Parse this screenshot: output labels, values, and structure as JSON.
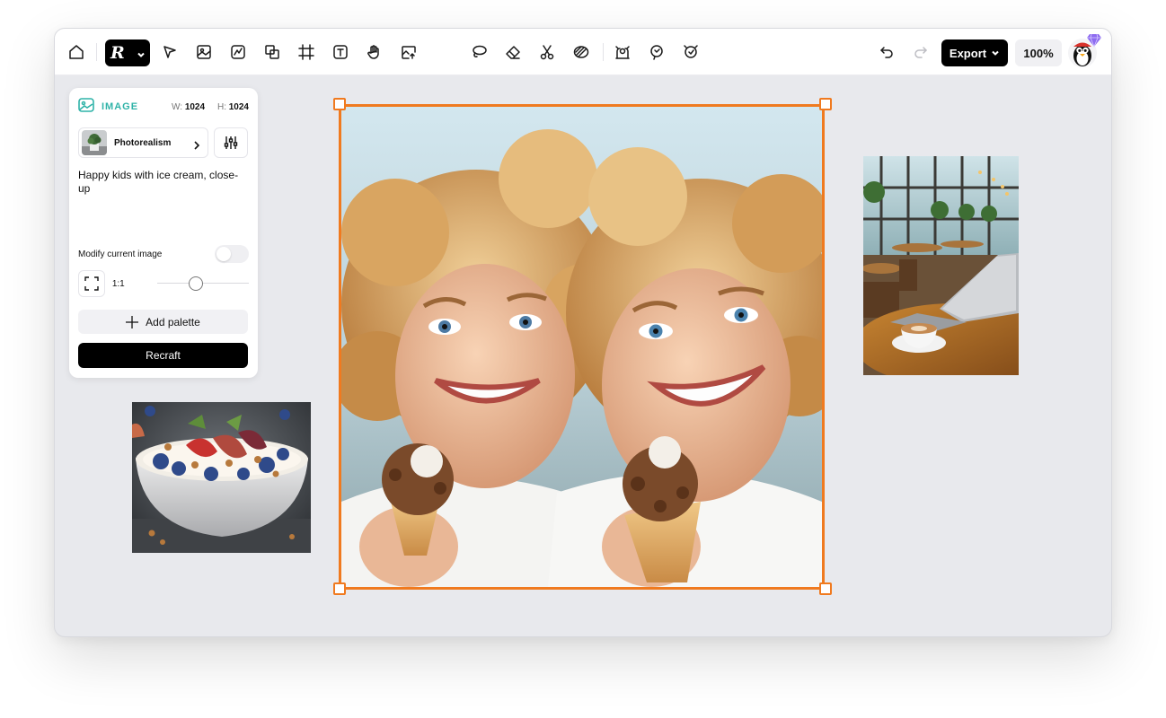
{
  "toolbar": {
    "tools": [
      {
        "name": "home"
      },
      {
        "name": "select"
      },
      {
        "name": "image"
      },
      {
        "name": "vector"
      },
      {
        "name": "layers"
      },
      {
        "name": "frame"
      },
      {
        "name": "text"
      },
      {
        "name": "hand"
      },
      {
        "name": "image-upload"
      },
      {
        "name": "lasso"
      },
      {
        "name": "eraser"
      },
      {
        "name": "scissors"
      },
      {
        "name": "pattern"
      },
      {
        "name": "background-remove"
      },
      {
        "name": "variations"
      },
      {
        "name": "creative-upscale"
      }
    ],
    "export_label": "Export",
    "zoom": "100%",
    "undo": "undo",
    "redo": "redo"
  },
  "panel": {
    "type_label": "IMAGE",
    "width_label": "W:",
    "width": "1024",
    "height_label": "H:",
    "height": "1024",
    "style_name": "Photorealism",
    "prompt": "Happy kids with ice cream, close-up",
    "modify_label": "Modify current image",
    "modify_enabled": false,
    "ratio": "1:1",
    "add_palette_label": "Add palette",
    "recraft_label": "Recraft"
  },
  "colors": {
    "accent": "#2fb3a8",
    "selection": "#f07a1f",
    "canvas": "#e8e9ed"
  }
}
